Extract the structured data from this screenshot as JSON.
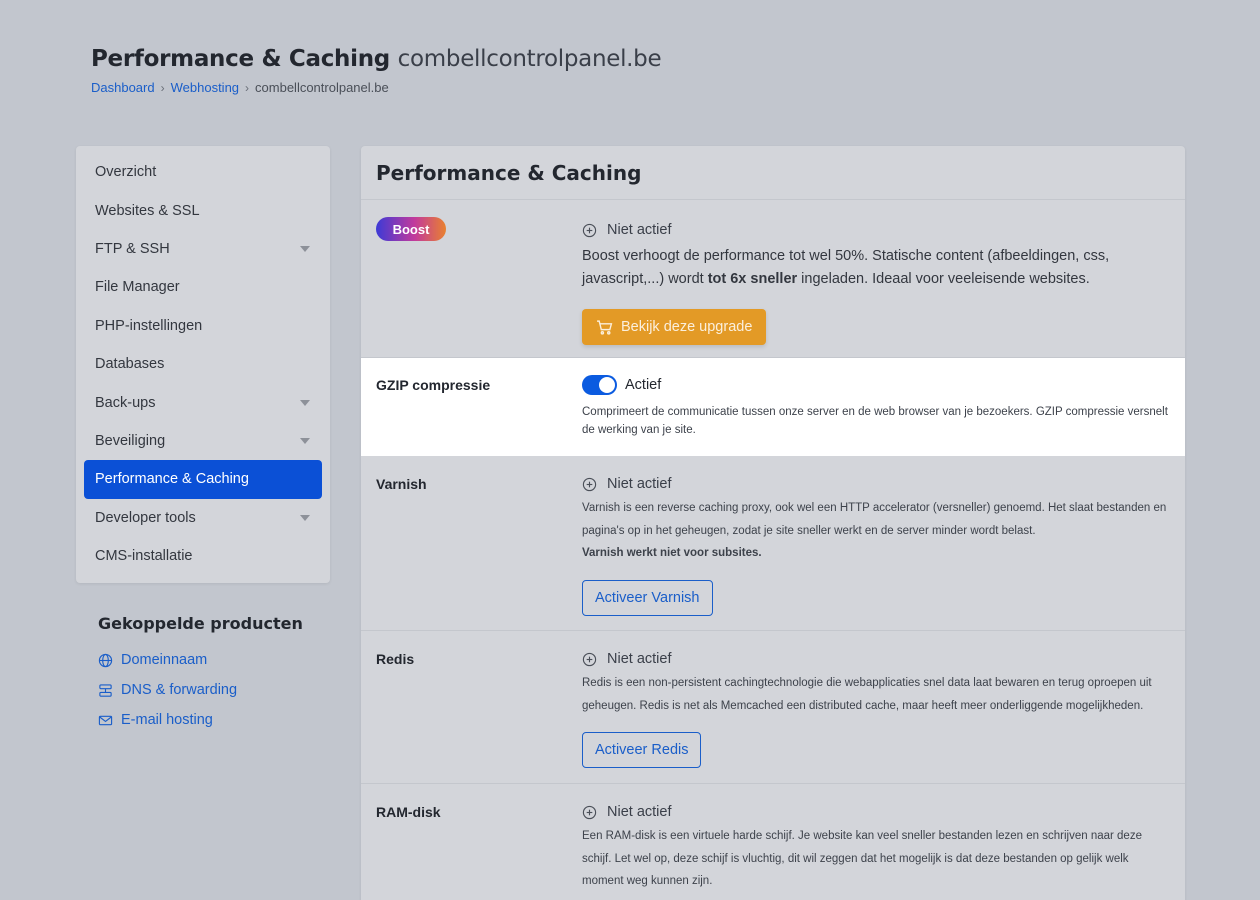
{
  "header": {
    "title": "Performance & Caching",
    "domain": "combellcontrolpanel.be",
    "breadcrumb": [
      "Dashboard",
      "Webhosting",
      "combellcontrolpanel.be"
    ]
  },
  "sidebar": {
    "items": [
      {
        "label": "Overzicht",
        "has_caret": false
      },
      {
        "label": "Websites & SSL",
        "has_caret": false
      },
      {
        "label": "FTP & SSH",
        "has_caret": true
      },
      {
        "label": "File Manager",
        "has_caret": false
      },
      {
        "label": "PHP-instellingen",
        "has_caret": false
      },
      {
        "label": "Databases",
        "has_caret": false
      },
      {
        "label": "Back-ups",
        "has_caret": true
      },
      {
        "label": "Beveiliging",
        "has_caret": true
      },
      {
        "label": "Performance & Caching",
        "has_caret": false,
        "active": true
      },
      {
        "label": "Developer tools",
        "has_caret": true
      },
      {
        "label": "CMS-installatie",
        "has_caret": false
      }
    ]
  },
  "linked": {
    "title": "Gekoppelde producten",
    "items": [
      {
        "label": "Domeinnaam",
        "icon": "globe-icon"
      },
      {
        "label": "DNS & forwarding",
        "icon": "server-icon"
      },
      {
        "label": "E-mail hosting",
        "icon": "mail-icon"
      }
    ]
  },
  "panel": {
    "title": "Performance & Caching",
    "boost": {
      "badge": "Boost",
      "status": "Niet actief",
      "desc_pre": "Boost verhoogt de performance tot wel 50%. Statische content (afbeeldingen, css, javascript,...) wordt ",
      "desc_bold": "tot 6x sneller",
      "desc_post": " ingeladen. Ideaal voor veeleisende websites.",
      "button": "Bekijk deze upgrade"
    },
    "gzip": {
      "label": "GZIP compressie",
      "status": "Actief",
      "enabled": true,
      "desc": "Comprimeert de communicatie tussen onze server en de web browser van je bezoekers. GZIP compressie versnelt de werking van je site."
    },
    "varnish": {
      "label": "Varnish",
      "status": "Niet actief",
      "desc": "Varnish is een reverse caching proxy, ook wel een HTTP accelerator (versneller) genoemd. Het slaat bestanden en pagina's op in het geheugen, zodat je site sneller werkt en de server minder wordt belast.",
      "note": "Varnish werkt niet voor subsites.",
      "button": "Activeer Varnish"
    },
    "redis": {
      "label": "Redis",
      "status": "Niet actief",
      "desc": "Redis is een non-persistent cachingtechnologie die webapplicaties snel data laat bewaren en terug oproepen uit geheugen. Redis is net als Memcached een distributed cache, maar heeft meer onderliggende mogelijkheden.",
      "button": "Activeer Redis"
    },
    "ramdisk": {
      "label": "RAM-disk",
      "status": "Niet actief",
      "desc": "Een RAM-disk is een virtuele harde schijf. Je website kan veel sneller bestanden lezen en schrijven naar deze schijf. Let wel op, deze schijf is vluchtig, dit wil zeggen dat het mogelijk is dat deze bestanden op gelijk welk moment weg kunnen zijn."
    }
  },
  "colors": {
    "accent": "#0b50d6",
    "link": "#1a5ec9",
    "upgrade": "#e39a26"
  }
}
